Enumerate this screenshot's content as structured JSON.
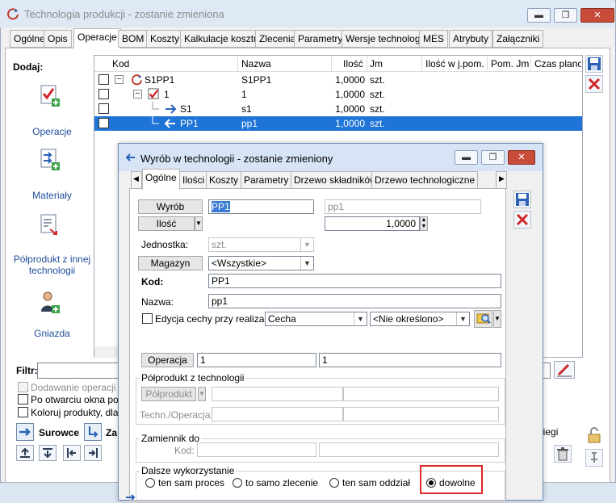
{
  "window": {
    "title": "Technologia produkcji - zostanie zmieniona",
    "minimize": "▬",
    "restore": "❐",
    "close": "✕"
  },
  "tabs": [
    "Ogólne",
    "Opis",
    "Operacje",
    "BOM",
    "Koszty",
    "Kalkulacje kosztu",
    "Zlecenia",
    "Parametry",
    "Wersje technologii",
    "MES",
    "Atrybuty",
    "Załączniki"
  ],
  "palette": {
    "title": "Dodaj:",
    "items": [
      "Operacje",
      "Materiały",
      "Półprodukt z innej technologii",
      "Gniazda"
    ]
  },
  "grid": {
    "columns": [
      "Kod",
      "Nazwa",
      "Ilość",
      "Jm",
      "Ilość w j.pom.",
      "Pom. Jm",
      "Czas planowany"
    ],
    "rows": [
      {
        "kod": "S1PP1",
        "nazwa": "S1PP1",
        "ilosc": "1,0000",
        "jm": "szt."
      },
      {
        "kod": "1",
        "nazwa": "1",
        "ilosc": "1,0000",
        "jm": "szt."
      },
      {
        "kod": "S1",
        "nazwa": "s1",
        "ilosc": "1,0000",
        "jm": "szt."
      },
      {
        "kod": "PP1",
        "nazwa": "pp1",
        "ilosc": "1,0000",
        "jm": "szt."
      }
    ]
  },
  "lower": {
    "filtr": "Filtr:",
    "dodawanie": "Dodawanie operacji w",
    "po_otwarciu": "Po otwarciu okna poka",
    "koloruj": "Koloruj produkty, dla k",
    "surowce": "Surowce",
    "za": "Za",
    "biegi": "biegi"
  },
  "dialog": {
    "title": "Wyrób w technologii - zostanie zmieniony",
    "tabs": [
      "Ogólne",
      "Ilości",
      "Koszty",
      "Parametry",
      "Drzewo składników",
      "Drzewo technologiczne"
    ],
    "wyrob_btn": "Wyrób",
    "wyrob_code": "PP1",
    "wyrob_name": "pp1",
    "ilosc_btn": "Ilość",
    "ilosc_value": "1,0000",
    "jednostka_label": "Jednostka:",
    "jednostka_value": "szt.",
    "magazyn_btn": "Magazyn",
    "magazyn_value": "<Wszystkie>",
    "kod_label": "Kod:",
    "kod_value": "PP1",
    "nazwa_label": "Nazwa:",
    "nazwa_value": "pp1",
    "edycja_label": "Edycja cechy przy realizacji",
    "cecha_value": "Cecha",
    "nieokreslono_value": "<Nie określono>",
    "operacja_btn": "Operacja",
    "operacja_val1": "1",
    "operacja_val2": "1",
    "polprodukt_group": "Półprodukt z technologii",
    "polprodukt_btn": "Półprodukt",
    "techn_label": "Techn./Operacja:",
    "zamiennik_group": "Zamiennik do",
    "zamiennik_kod_label": "Kod:",
    "dalsze_group": "Dalsze wykorzystanie",
    "radio": [
      "ten sam proces",
      "to samo zlecenie",
      "ten sam oddział",
      "dowolne"
    ],
    "radio_selected": 3
  }
}
